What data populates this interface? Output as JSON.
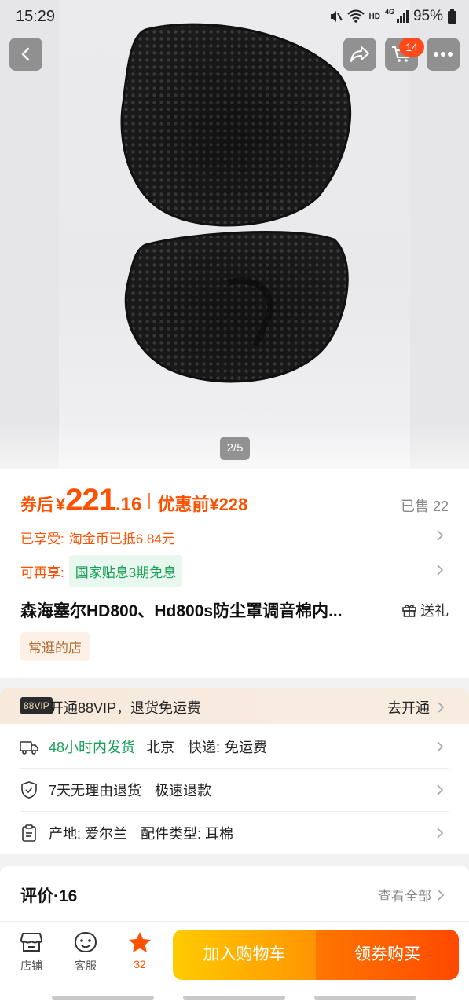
{
  "status_bar": {
    "time": "15:29",
    "network_label": "HD",
    "network_gen": "4G",
    "battery": "95%"
  },
  "header": {
    "cart_count": "14",
    "image_position": "2/5"
  },
  "price": {
    "after_coupon_label": "券后",
    "currency": "¥",
    "integer": "221",
    "decimal": ".16",
    "before_label": "优惠前¥228",
    "sold": "已售 22"
  },
  "benefits": {
    "enjoyed_label": "已享受:",
    "enjoyed_value": "淘金币已抵6.84元",
    "available_label": "可再享:",
    "available_value": "国家贴息3期免息"
  },
  "product": {
    "title": "森海塞尔HD800、Hd800s防尘罩调音棉内...",
    "gift_label": "送礼",
    "shop_tag": "常逛的店"
  },
  "vip": {
    "badge": "88VIP",
    "text": "开通88VIP，退货免运费",
    "action": "去开通"
  },
  "services": {
    "shipping_time": "48小时内发货",
    "shipping_from": "北京",
    "express_label": "快递:",
    "express_value": "免运费",
    "return_policy": "7天无理由退货",
    "refund": "极速退款",
    "origin": "产地: 爱尔兰",
    "part_type": "配件类型: 耳棉"
  },
  "reviews": {
    "title": "评价·16",
    "view_all": "查看全部"
  },
  "bottom_bar": {
    "store_label": "店铺",
    "service_label": "客服",
    "favorite_count": "32",
    "add_to_cart": "加入购物车",
    "buy_label": "领券购买"
  },
  "colors": {
    "accent": "#ff5000",
    "green": "#1aa05a",
    "cart_button": "#ffb300",
    "buy_button": "#ff5a00"
  }
}
